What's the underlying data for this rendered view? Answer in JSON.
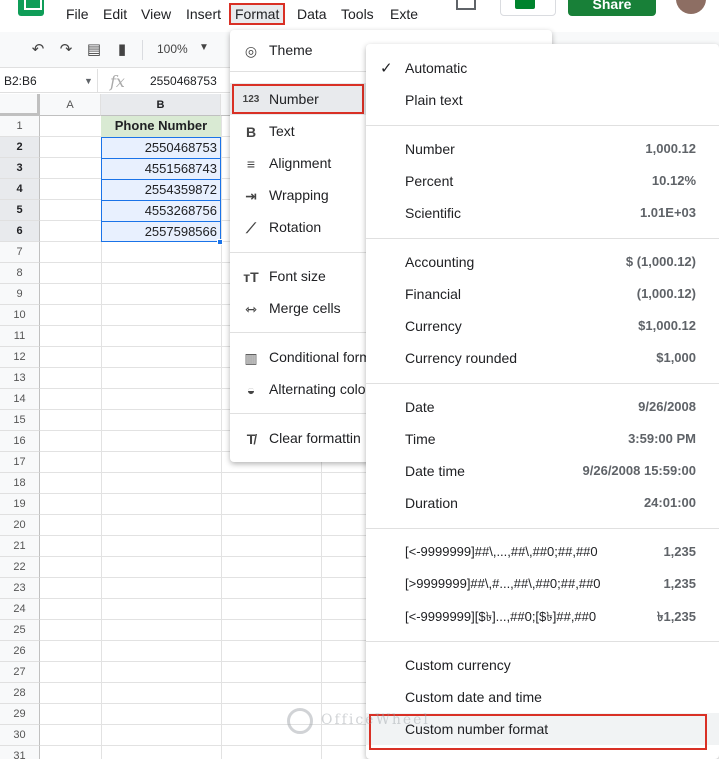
{
  "menubar": {
    "items": [
      "File",
      "Edit",
      "View",
      "Insert",
      "Format",
      "Data",
      "Tools",
      "Exten"
    ],
    "active": "Format",
    "share_label": "Share"
  },
  "toolbar": {
    "zoom": "100%"
  },
  "formula_bar": {
    "name_box": "B2:B6",
    "fx": "fx",
    "value": "2550468753"
  },
  "grid": {
    "columns": [
      "A",
      "B"
    ],
    "rows": [
      "1",
      "2",
      "3",
      "4",
      "5",
      "6",
      "7",
      "8",
      "9",
      "10",
      "11",
      "12",
      "13",
      "14",
      "15",
      "16",
      "17",
      "18",
      "19",
      "20",
      "21",
      "22",
      "23",
      "24",
      "25",
      "26",
      "27",
      "28",
      "29",
      "30",
      "31"
    ],
    "header_cell": "Phone Number",
    "values": [
      "2550468753",
      "4551568743",
      "2554359872",
      "4553268756",
      "2557598566"
    ]
  },
  "format_menu": {
    "items": [
      {
        "label": "Theme",
        "icon": "palette-icon"
      },
      {
        "label": "Number",
        "icon": "number-123-icon"
      },
      {
        "label": "Text",
        "icon": "bold-icon"
      },
      {
        "label": "Alignment",
        "icon": "align-icon"
      },
      {
        "label": "Wrapping",
        "icon": "wrap-icon"
      },
      {
        "label": "Rotation",
        "icon": "rotation-icon"
      },
      {
        "label": "Font size",
        "icon": "font-size-icon"
      },
      {
        "label": "Merge cells",
        "icon": "merge-icon"
      },
      {
        "label": "Conditional form",
        "icon": "conditional-format-icon"
      },
      {
        "label": "Alternating colo",
        "icon": "fill-drop-icon"
      },
      {
        "label": "Clear formattin",
        "icon": "clear-format-icon"
      }
    ]
  },
  "number_menu": {
    "groups": [
      [
        {
          "label": "Automatic",
          "value": "",
          "checked": true
        },
        {
          "label": "Plain text",
          "value": ""
        }
      ],
      [
        {
          "label": "Number",
          "value": "1,000.12"
        },
        {
          "label": "Percent",
          "value": "10.12%"
        },
        {
          "label": "Scientific",
          "value": "1.01E+03"
        }
      ],
      [
        {
          "label": "Accounting",
          "value": "$ (1,000.12)"
        },
        {
          "label": "Financial",
          "value": "(1,000.12)"
        },
        {
          "label": "Currency",
          "value": "$1,000.12"
        },
        {
          "label": "Currency rounded",
          "value": "$1,000"
        }
      ],
      [
        {
          "label": "Date",
          "value": "9/26/2008"
        },
        {
          "label": "Time",
          "value": "3:59:00 PM"
        },
        {
          "label": "Date time",
          "value": "9/26/2008 15:59:00"
        },
        {
          "label": "Duration",
          "value": "24:01:00"
        }
      ],
      [
        {
          "label": "[<-9999999]##\\,...,##\\,##0;##,##0",
          "value": "1,235"
        },
        {
          "label": "[>9999999]##\\,#...,##\\,##0;##,##0",
          "value": "1,235"
        },
        {
          "label": "[<-9999999][$৳]...,##0;[$৳]##,##0",
          "value": "৳1,235"
        }
      ],
      [
        {
          "label": "Custom currency",
          "value": ""
        },
        {
          "label": "Custom date and time",
          "value": ""
        },
        {
          "label": "Custom number format",
          "value": ""
        }
      ]
    ]
  },
  "watermark": {
    "text": "OfficeWheel"
  }
}
